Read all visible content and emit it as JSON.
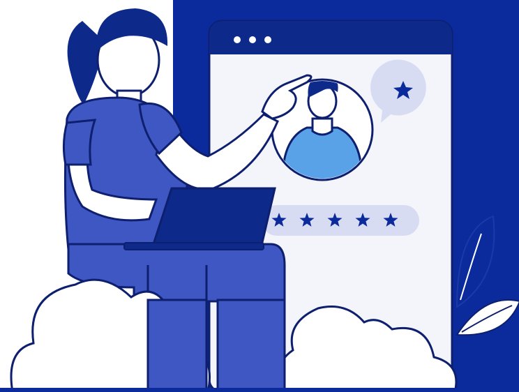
{
  "illustration": {
    "window_controls": [
      "dot",
      "dot",
      "dot"
    ],
    "rating_stars": 5,
    "badge_icon": "star-icon",
    "colors": {
      "brand_dark": "#0b2a9b",
      "brand_mid": "#3f57c2",
      "brand_light": "#d7dcf3",
      "accent_blue": "#5aa2e8",
      "outline": "#0d1f6e",
      "white": "#ffffff"
    }
  }
}
